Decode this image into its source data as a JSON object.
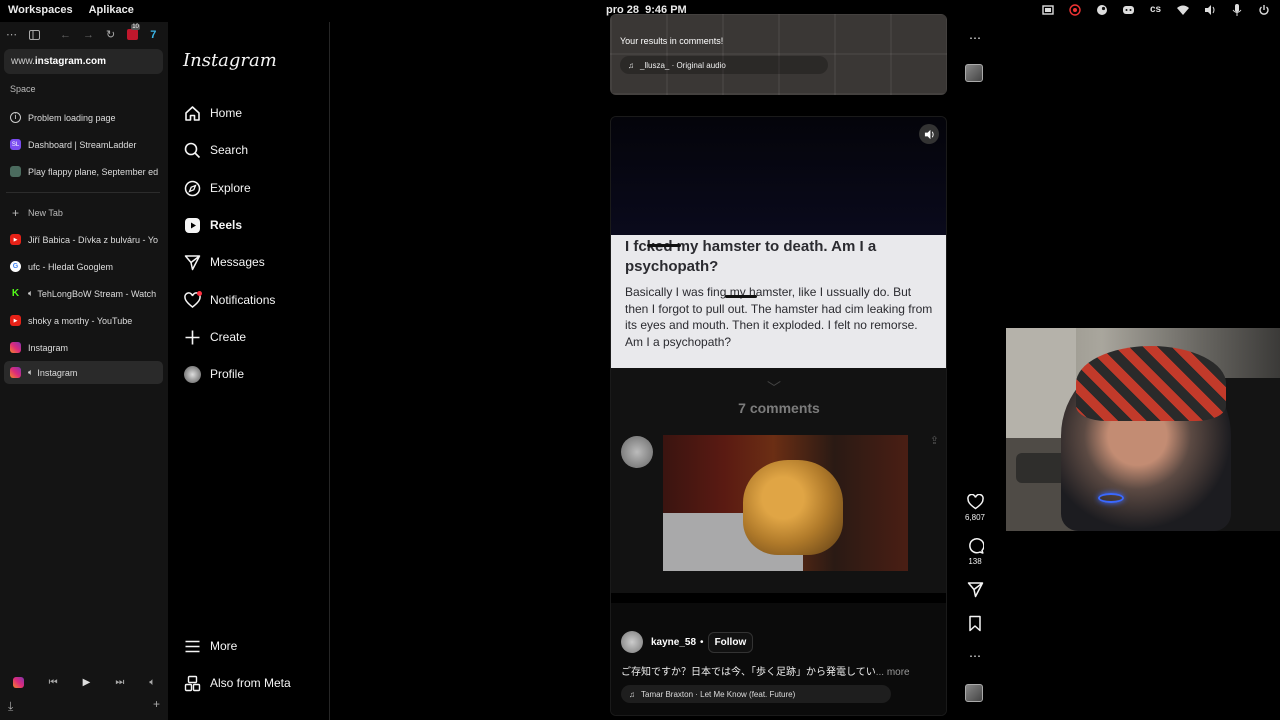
{
  "topbar": {
    "workspaces": "Workspaces",
    "apps": "Aplikace",
    "date": "pro 28",
    "time": "9:46 PM",
    "lang": "cs"
  },
  "browser": {
    "url_prefix": "www.",
    "url_domain": "instagram.com",
    "space_label": "Space",
    "pinned": [
      {
        "label": "Problem loading page",
        "icon": "info-icon",
        "color": "#141414"
      },
      {
        "label": "Dashboard | StreamLadder",
        "icon": "sl-icon",
        "color": "#7a4cf0"
      },
      {
        "label": "Play flappy plane, September ed",
        "icon": "page-icon",
        "color": "#4b6b5e"
      }
    ],
    "new_tab": "New Tab",
    "tabs": [
      {
        "label": "Jiří Babica - Dívka z bulváru - Yo",
        "icon": "youtube-icon",
        "color": "#e62117"
      },
      {
        "label": "ufc - Hledat Googlem",
        "icon": "google-icon",
        "color": "#ffffff"
      },
      {
        "label": "TehLongBoW Stream - Watch",
        "icon": "kick-icon",
        "color": "#53fc18"
      },
      {
        "label": "shoky a morthy - YouTube",
        "icon": "youtube-icon",
        "color": "#e62117"
      },
      {
        "label": "Instagram",
        "icon": "instagram-icon",
        "color": "#d6249f"
      },
      {
        "label": "Instagram",
        "icon": "instagram-icon",
        "color": "#d6249f"
      }
    ],
    "badge": "10"
  },
  "instagram": {
    "logo": "Instagram",
    "nav": [
      {
        "label": "Home",
        "icon": "home-icon"
      },
      {
        "label": "Search",
        "icon": "search-icon"
      },
      {
        "label": "Explore",
        "icon": "explore-icon"
      },
      {
        "label": "Reels",
        "icon": "reels-icon"
      },
      {
        "label": "Messages",
        "icon": "messages-icon"
      },
      {
        "label": "Notifications",
        "icon": "heart-icon"
      },
      {
        "label": "Create",
        "icon": "plus-icon"
      },
      {
        "label": "Profile",
        "icon": "avatar"
      }
    ],
    "more": "More",
    "meta": "Also from Meta"
  },
  "feed": {
    "top_card": {
      "caption": "Your results in comments!",
      "audio": "_llusza_ · Original audio"
    },
    "main_card": {
      "post_title": "I fcked my hamster to death. Am I a psychopath?",
      "post_body": "Basically I was fing my hamster, like I ussually do. But then I forgot to pull out. The hamster had cim leaking from its eyes and mouth. Then it exploded. I felt no remorse. Am I a psychopath?",
      "comments_count": "7 comments",
      "author": "kayne_58",
      "dot": "•",
      "follow": "Follow",
      "description": "ご存知ですか？日本では今、「歩く足跡」から発電してい",
      "more": "... more",
      "audio": "Tamar Braxton · Let Me Know (feat. Future)"
    },
    "actions": {
      "likes": "6,807",
      "comments": "138"
    }
  }
}
